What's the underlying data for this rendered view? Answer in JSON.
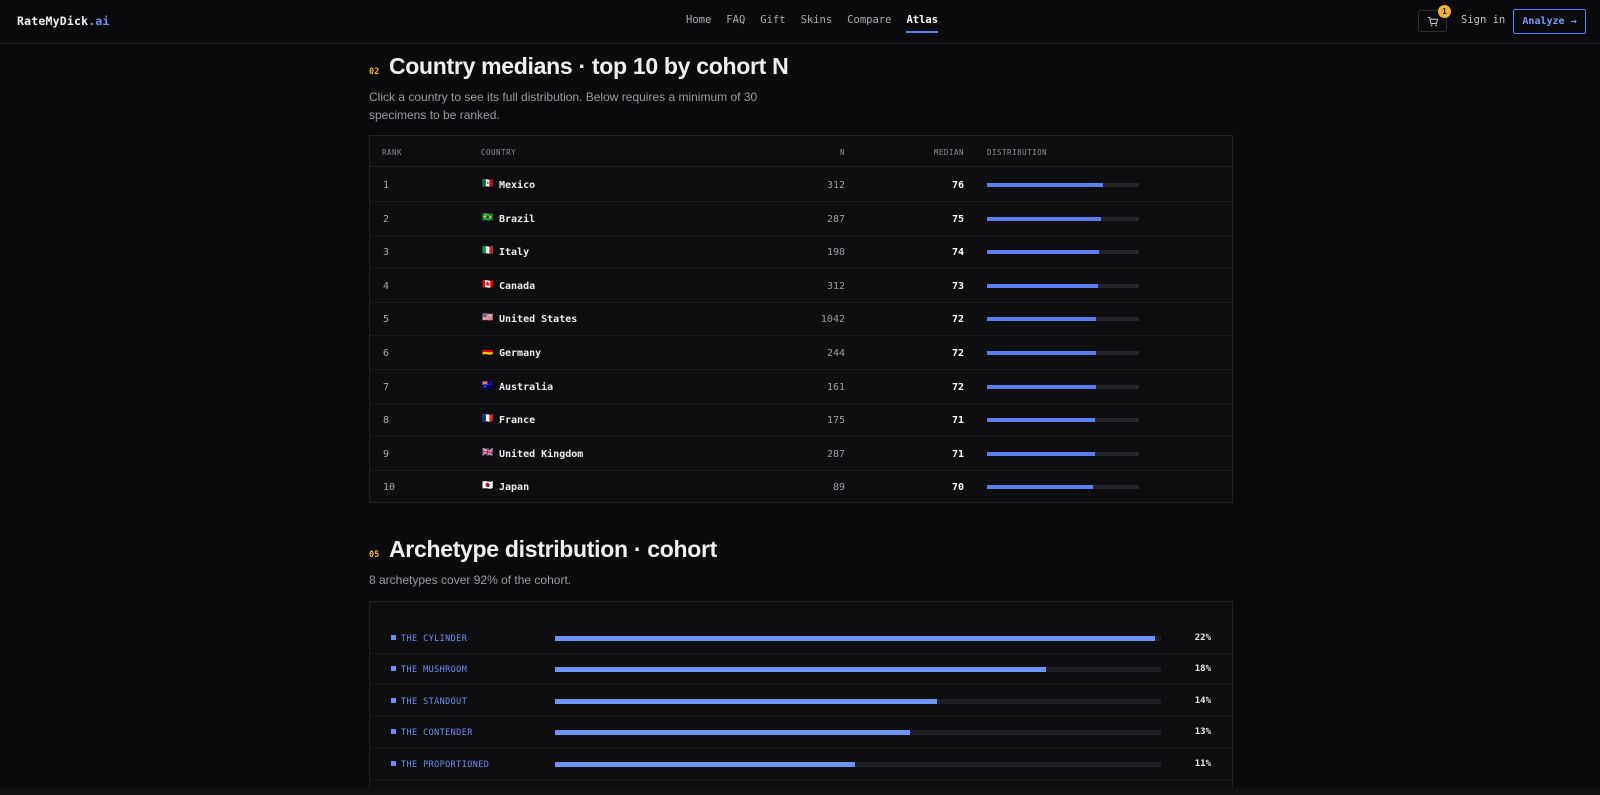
{
  "header": {
    "brand": "RateMyDick",
    "brand_tld": ".ai",
    "nav": [
      "Home",
      "FAQ",
      "Gift",
      "Skins",
      "Compare",
      "Atlas"
    ],
    "active_nav": "Atlas",
    "cart_count": "1",
    "signin": "Sign in",
    "analyze": "Analyze →"
  },
  "countries_section": {
    "number": "02",
    "title": "Country medians · top 10 by cohort N",
    "description": "Click a country to see its full distribution. Below requires a minimum of 30 specimens to be ranked.",
    "columns": [
      "RANK",
      "COUNTRY",
      "N",
      "MEDIAN",
      "DISTRIBUTION"
    ],
    "rows": [
      {
        "rank": "1",
        "flag": "🇲🇽",
        "country": "Mexico",
        "n": "312",
        "median": "76",
        "dist": 0.76
      },
      {
        "rank": "2",
        "flag": "🇧🇷",
        "country": "Brazil",
        "n": "287",
        "median": "75",
        "dist": 0.75
      },
      {
        "rank": "3",
        "flag": "🇮🇹",
        "country": "Italy",
        "n": "198",
        "median": "74",
        "dist": 0.74
      },
      {
        "rank": "4",
        "flag": "🇨🇦",
        "country": "Canada",
        "n": "312",
        "median": "73",
        "dist": 0.73
      },
      {
        "rank": "5",
        "flag": "🇺🇸",
        "country": "United States",
        "n": "1042",
        "median": "72",
        "dist": 0.72
      },
      {
        "rank": "6",
        "flag": "🇩🇪",
        "country": "Germany",
        "n": "244",
        "median": "72",
        "dist": 0.72
      },
      {
        "rank": "7",
        "flag": "🇦🇺",
        "country": "Australia",
        "n": "161",
        "median": "72",
        "dist": 0.72
      },
      {
        "rank": "8",
        "flag": "🇫🇷",
        "country": "France",
        "n": "175",
        "median": "71",
        "dist": 0.71
      },
      {
        "rank": "9",
        "flag": "🇬🇧",
        "country": "United Kingdom",
        "n": "287",
        "median": "71",
        "dist": 0.71
      },
      {
        "rank": "10",
        "flag": "🇯🇵",
        "country": "Japan",
        "n": "89",
        "median": "70",
        "dist": 0.7
      }
    ]
  },
  "archetype_section": {
    "number": "05",
    "title": "Archetype distribution · cohort",
    "description": "8 archetypes cover 92% of the cohort.",
    "rows": [
      {
        "name": "THE CYLINDER",
        "pct": "22%",
        "fill": 0.99
      },
      {
        "name": "THE MUSHROOM",
        "pct": "18%",
        "fill": 0.81
      },
      {
        "name": "THE STANDOUT",
        "pct": "14%",
        "fill": 0.63
      },
      {
        "name": "THE CONTENDER",
        "pct": "13%",
        "fill": 0.585
      },
      {
        "name": "THE PROPORTIONED",
        "pct": "11%",
        "fill": 0.495
      }
    ]
  },
  "colors": {
    "accent": "#5b7ff0",
    "section_number": "#f2b134",
    "background": "#0b0b0d"
  }
}
